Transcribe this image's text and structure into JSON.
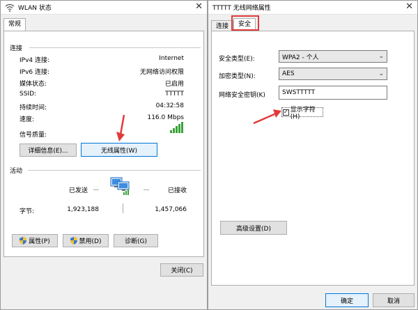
{
  "left_window": {
    "title": "WLAN 状态",
    "tab": "常规",
    "connection": {
      "title": "连接",
      "rows": [
        {
          "label": "IPv4 连接:",
          "value": "Internet"
        },
        {
          "label": "IPv6 连接:",
          "value": "无网络访问权限"
        },
        {
          "label": "媒体状态:",
          "value": "已启用"
        },
        {
          "label": "SSID:",
          "value": "TTTTT"
        },
        {
          "label": "持续时间:",
          "value": "04:32:58"
        },
        {
          "label": "速度:",
          "value": "116.0 Mbps"
        }
      ],
      "signal_label": "信号质量:",
      "details_button": "详细信息(E)...",
      "wireless_props_button": "无线属性(W)"
    },
    "activity": {
      "title": "活动",
      "sent_label": "已发送",
      "received_label": "已接收",
      "bytes_label": "字节:",
      "bytes_sent": "1,923,188",
      "bytes_received": "1,457,066"
    },
    "buttons": {
      "properties": "属性(P)",
      "disable": "禁用(D)",
      "diagnose": "诊断(G)",
      "close": "关闭(C)"
    }
  },
  "right_window": {
    "title": "TTTTT 无线网络属性",
    "tabs": [
      "连接",
      "安全"
    ],
    "security_type_label": "安全类型(E):",
    "security_type_value": "WPA2 - 个人",
    "encryption_label": "加密类型(N):",
    "encryption_value": "AES",
    "key_label": "网络安全密钥(K)",
    "key_value": "SWSTTTTT",
    "show_chars_label": "显示字符(H)",
    "show_chars_checked": true,
    "advanced_button": "高级设置(D)",
    "ok_button": "确定",
    "cancel_button": "取消"
  },
  "colors": {
    "accent_blue": "#0078d7",
    "highlight_red": "#e03b3b",
    "signal_green": "#3aa33a"
  }
}
